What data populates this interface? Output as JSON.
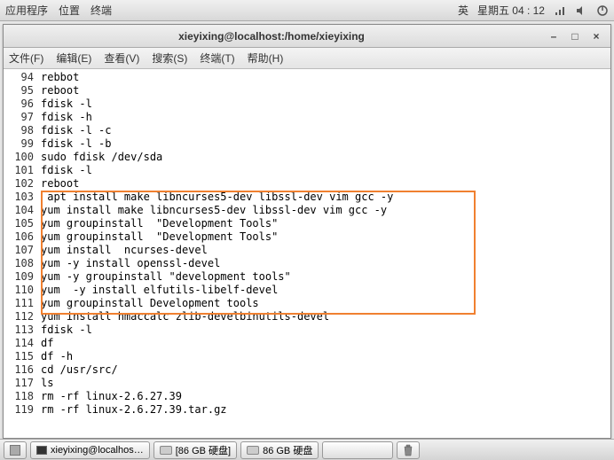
{
  "top_panel": {
    "apps": "应用程序",
    "places": "位置",
    "terminal": "终端",
    "ime": "英",
    "date": "星期五 04 : 12"
  },
  "window": {
    "title": "xieyixing@localhost:/home/xieyixing"
  },
  "menu": {
    "file": "文件(F)",
    "edit": "编辑(E)",
    "view": "查看(V)",
    "search": "搜索(S)",
    "terminal": "终端(T)",
    "help": "帮助(H)"
  },
  "lines": [
    {
      "n": "94",
      "t": "rebbot"
    },
    {
      "n": "95",
      "t": "reboot"
    },
    {
      "n": "96",
      "t": "fdisk -l"
    },
    {
      "n": "97",
      "t": "fdisk -h"
    },
    {
      "n": "98",
      "t": "fdisk -l -c"
    },
    {
      "n": "99",
      "t": "fdisk -l -b"
    },
    {
      "n": "100",
      "t": "sudo fdisk /dev/sda"
    },
    {
      "n": "101",
      "t": "fdisk -l"
    },
    {
      "n": "102",
      "t": "reboot"
    },
    {
      "n": "103",
      "t": " apt install make libncurses5-dev libssl-dev vim gcc -y"
    },
    {
      "n": "104",
      "t": "yum install make libncurses5-dev libssl-dev vim gcc -y"
    },
    {
      "n": "105",
      "t": "yum groupinstall  \"Development Tools\""
    },
    {
      "n": "106",
      "t": "yum groupinstall  \"Development Tools\""
    },
    {
      "n": "107",
      "t": "yum install  ncurses-devel"
    },
    {
      "n": "108",
      "t": "yum -y install openssl-devel"
    },
    {
      "n": "109",
      "t": "yum -y groupinstall \"development tools\""
    },
    {
      "n": "110",
      "t": "yum  -y install elfutils-libelf-devel"
    },
    {
      "n": "111",
      "t": "yum groupinstall Development tools"
    },
    {
      "n": "112",
      "t": "yum install hmaccalc zlib-develbinutils-devel"
    },
    {
      "n": "113",
      "t": "fdisk -l"
    },
    {
      "n": "114",
      "t": "df"
    },
    {
      "n": "115",
      "t": "df -h"
    },
    {
      "n": "116",
      "t": "cd /usr/src/"
    },
    {
      "n": "117",
      "t": "ls"
    },
    {
      "n": "118",
      "t": "rm -rf linux-2.6.27.39"
    },
    {
      "n": "119",
      "t": "rm -rf linux-2.6.27.39.tar.gz"
    }
  ],
  "taskbar": {
    "task1": "xieyixing@localhos…",
    "task2": "[86 GB 硬盘]",
    "task3": "86 GB 硬盘"
  }
}
